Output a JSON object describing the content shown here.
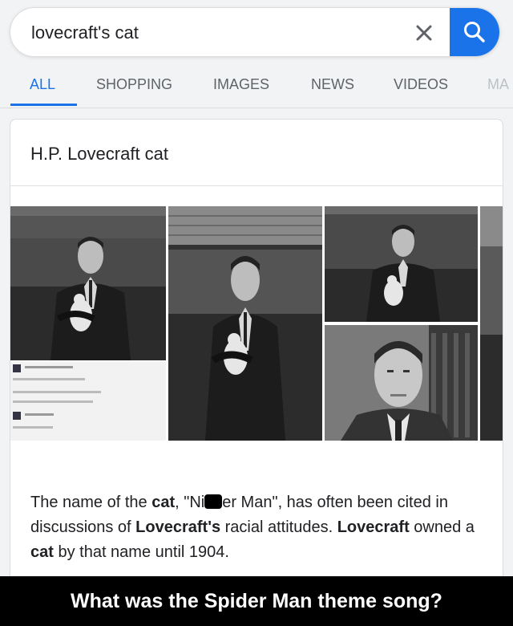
{
  "search": {
    "query": "lovecraft's cat",
    "clear_icon": "close-icon",
    "search_icon": "search-icon"
  },
  "tabs": [
    {
      "label": "ALL",
      "active": true
    },
    {
      "label": "SHOPPING"
    },
    {
      "label": "IMAGES"
    },
    {
      "label": "NEWS"
    },
    {
      "label": "VIDEOS"
    },
    {
      "label": "MA"
    }
  ],
  "card": {
    "title": "H.P. Lovecraft cat",
    "snippet": {
      "part1": "The name of the ",
      "bold1": "cat",
      "part2": ", \"Ni",
      "part3": "er Man\", has often been cited in discussions of ",
      "bold2": "Lovecraft's",
      "part4": " racial attitudes. ",
      "bold3": "Lovecraft",
      "part5": " owned a ",
      "bold4": "cat",
      "part6": " by that name until 1904."
    }
  },
  "caption": "What was the Spider Man theme song?",
  "colors": {
    "accent": "#1a73e8",
    "caption_bg": "#000000"
  }
}
